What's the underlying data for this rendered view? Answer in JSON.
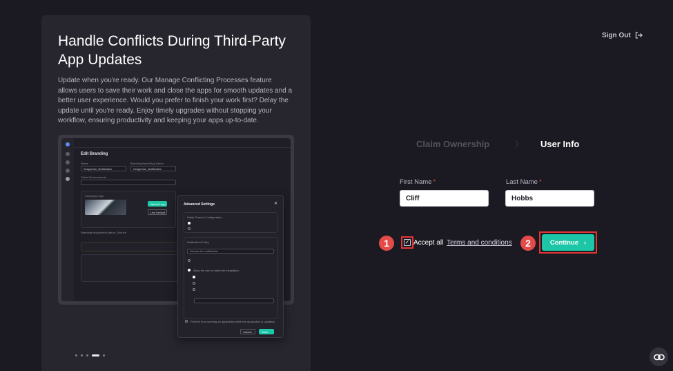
{
  "hero": {
    "title": "Handle Conflicts During Third-Party App Updates",
    "description": "Update when you're ready. Our Manage Conflicting Processes feature allows users to save their work and close the apps for smooth updates and a better user experience. Would you prefer to finish your work first? Delay the update until you're ready. Enjoy timely upgrades without stopping your workflow, ensuring productivity and keeping your apps up-to-date."
  },
  "preview": {
    "page_title": "Edit Branding",
    "name_label": "Name",
    "name_value": "Scappman_Notification",
    "branding_label": "Branding Name/App Name",
    "branding_value": "Scappman_Notification",
    "environments_label": "Select Environments",
    "company_logo_label": "Company Logo",
    "upload_logo": "Upload Logo",
    "use_default": "Use Default",
    "deployment_status": "Branding deployment status: Queued",
    "modal": {
      "title": "Advanced Settings",
      "section_timeout": "Notify Timeout Configuration",
      "section_policy": "Notification Policy",
      "option_dismiss": "Dismiss the notification",
      "option_allow_defer": "Allow the user to defer the installation",
      "option_prevent": "Prevent from opening an application while the application is updating",
      "cancel": "Cancel",
      "save": "Save"
    }
  },
  "carousel": {
    "slides": 5,
    "active_index": 3
  },
  "signout": {
    "label": "Sign Out"
  },
  "steps": {
    "step1": "Claim Ownership",
    "separator": ")",
    "step2": "User Info"
  },
  "form": {
    "first_name_label": "First Name",
    "first_name_value": "Cliff",
    "last_name_label": "Last Name",
    "last_name_value": "Hobbs",
    "required_mark": "*",
    "accept_prefix": "Accept all",
    "terms_link": "Terms and conditions",
    "checkbox_checked": true,
    "continue_label": "Continue",
    "continue_chevron": "›"
  },
  "callouts": {
    "one": "1",
    "two": "2"
  },
  "colors": {
    "background": "#1b1a22",
    "panel": "#27262f",
    "accent": "#1cc6a6",
    "highlight": "#e53636",
    "callout": "#e34a48"
  }
}
